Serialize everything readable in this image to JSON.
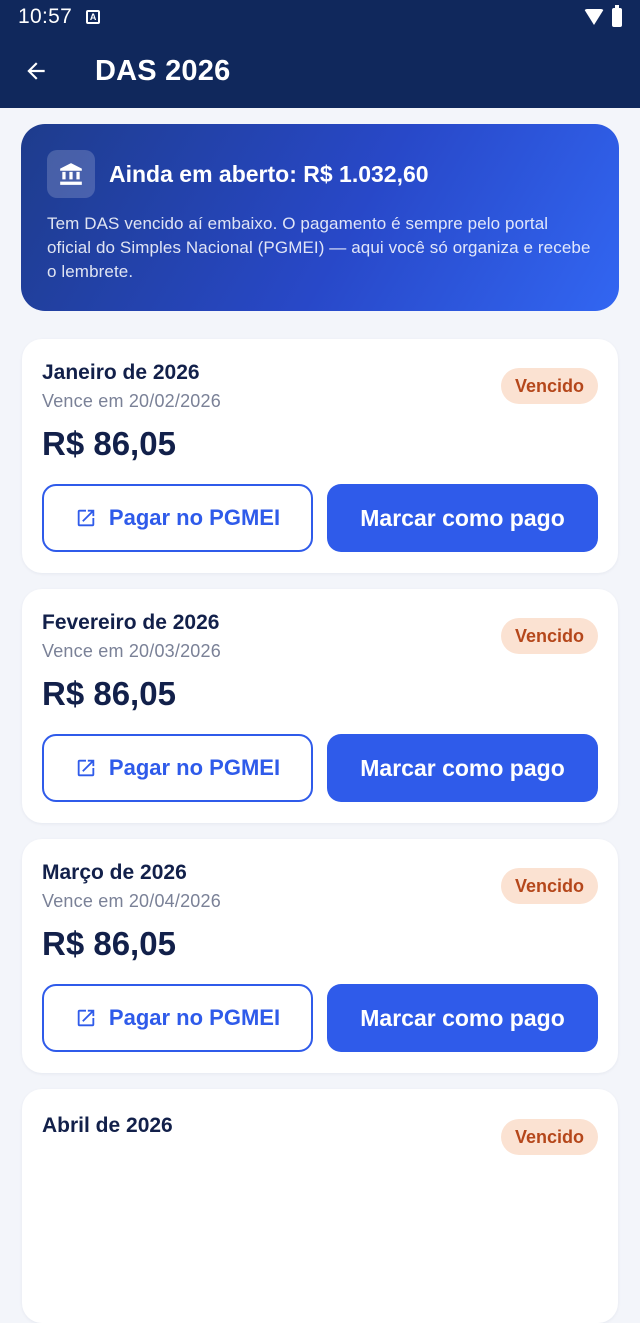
{
  "status_bar": {
    "time": "10:57",
    "notification_icon": "A"
  },
  "app_bar": {
    "title": "DAS 2026"
  },
  "summary": {
    "title": "Ainda em aberto: R$ 1.032,60",
    "text": "Tem DAS vencido aí embaixo. O pagamento é sempre pelo portal oficial do Simples Nacional (PGMEI) — aqui você só organiza e recebe o lembrete."
  },
  "cards": [
    {
      "month": "Janeiro de 2026",
      "due": "Vence em 20/02/2026",
      "amount": "R$ 86,05",
      "status": "Vencido",
      "pay_label": "Pagar no PGMEI",
      "mark_label": "Marcar como pago"
    },
    {
      "month": "Fevereiro de 2026",
      "due": "Vence em 20/03/2026",
      "amount": "R$ 86,05",
      "status": "Vencido",
      "pay_label": "Pagar no PGMEI",
      "mark_label": "Marcar como pago"
    },
    {
      "month": "Março de 2026",
      "due": "Vence em 20/04/2026",
      "amount": "R$ 86,05",
      "status": "Vencido",
      "pay_label": "Pagar no PGMEI",
      "mark_label": "Marcar como pago"
    },
    {
      "month": "Abril de 2026",
      "status": "Vencido"
    }
  ],
  "colors": {
    "app_bar": "#10285C",
    "primary": "#2F5BEA",
    "badge_bg": "#FBE2D2",
    "badge_text": "#B5471B"
  }
}
